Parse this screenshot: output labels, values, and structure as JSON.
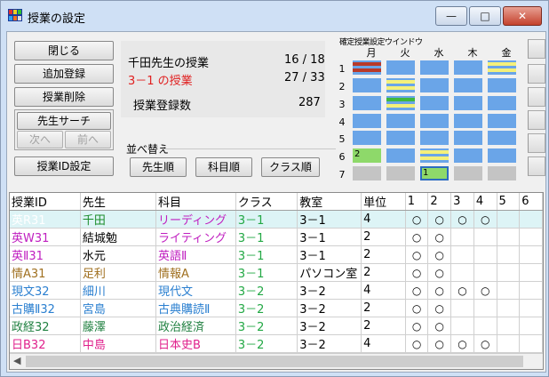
{
  "window": {
    "title": "授業の設定",
    "min": "—",
    "max": "□",
    "close": "✕"
  },
  "buttons": {
    "close": "閉じる",
    "add": "追加登録",
    "delete": "授業削除",
    "teacher_search": "先生サーチ",
    "next": "次へ",
    "prev": "前へ",
    "id_setting": "授業ID設定"
  },
  "info": {
    "teacher_label": "千田先生の授業",
    "teacher_count": "16 / 18",
    "class_label": "3－1 の授業",
    "class_count": "27 / 33",
    "total_label": "授業登録数",
    "total_count": "287"
  },
  "sort": {
    "label": "並べ替え",
    "by_teacher": "先生順",
    "by_subject": "科目順",
    "by_class": "クラス順"
  },
  "schedule": {
    "title": "確定授業設定ウインドウ",
    "days": [
      "月",
      "火",
      "水",
      "木",
      "金"
    ],
    "periods": [
      "1",
      "2",
      "3",
      "4",
      "5",
      "6",
      "7"
    ],
    "cell_labels": {
      "p6_mon": "2",
      "p7_wed": "1"
    }
  },
  "table": {
    "headers": [
      "授業ID",
      "先生",
      "科目",
      "クラス",
      "教室",
      "単位",
      "1",
      "2",
      "3",
      "4",
      "5",
      "6"
    ],
    "rows": [
      {
        "id": "英R31",
        "teacher": "千田",
        "subject": "リーディング",
        "class": "3－1",
        "room": "3－1",
        "units": "4",
        "p": [
          "○",
          "○",
          "○",
          "○",
          "",
          ""
        ]
      },
      {
        "id": "英W31",
        "teacher": "結城勉",
        "subject": "ライティング",
        "class": "3－1",
        "room": "3－1",
        "units": "2",
        "p": [
          "○",
          "○",
          "",
          "",
          "",
          ""
        ]
      },
      {
        "id": "英Ⅱ31",
        "teacher": "水元",
        "subject": "英語Ⅱ",
        "class": "3－1",
        "room": "3－1",
        "units": "2",
        "p": [
          "○",
          "○",
          "",
          "",
          "",
          ""
        ]
      },
      {
        "id": "情A31",
        "teacher": "足利",
        "subject": "情報A",
        "class": "3－1",
        "room": "パソコン室",
        "units": "2",
        "p": [
          "○",
          "○",
          "",
          "",
          "",
          ""
        ]
      },
      {
        "id": "現文32",
        "teacher": "細川",
        "subject": "現代文",
        "class": "3－2",
        "room": "3－2",
        "units": "4",
        "p": [
          "○",
          "○",
          "○",
          "○",
          "",
          ""
        ]
      },
      {
        "id": "古購Ⅱ32",
        "teacher": "宮島",
        "subject": "古典購読Ⅱ",
        "class": "3－2",
        "room": "3－2",
        "units": "2",
        "p": [
          "○",
          "○",
          "",
          "",
          "",
          ""
        ]
      },
      {
        "id": "政経32",
        "teacher": "藤澤",
        "subject": "政治経済",
        "class": "3－2",
        "room": "3－2",
        "units": "2",
        "p": [
          "○",
          "○",
          "",
          "",
          "",
          ""
        ]
      },
      {
        "id": "日B32",
        "teacher": "中島",
        "subject": "日本史B",
        "class": "3－2",
        "room": "3－2",
        "units": "4",
        "p": [
          "○",
          "○",
          "○",
          "○",
          "",
          ""
        ]
      }
    ]
  },
  "colors": {
    "english": "#c01fc0",
    "english_id": "#c01fc0",
    "teacher_green": "#1a8c2a",
    "info": "#a07020",
    "japanese": "#2a7fd0",
    "social": "#208040",
    "history": "#e0208c",
    "class_green": "#22a844",
    "selection": "#0a67d6"
  }
}
